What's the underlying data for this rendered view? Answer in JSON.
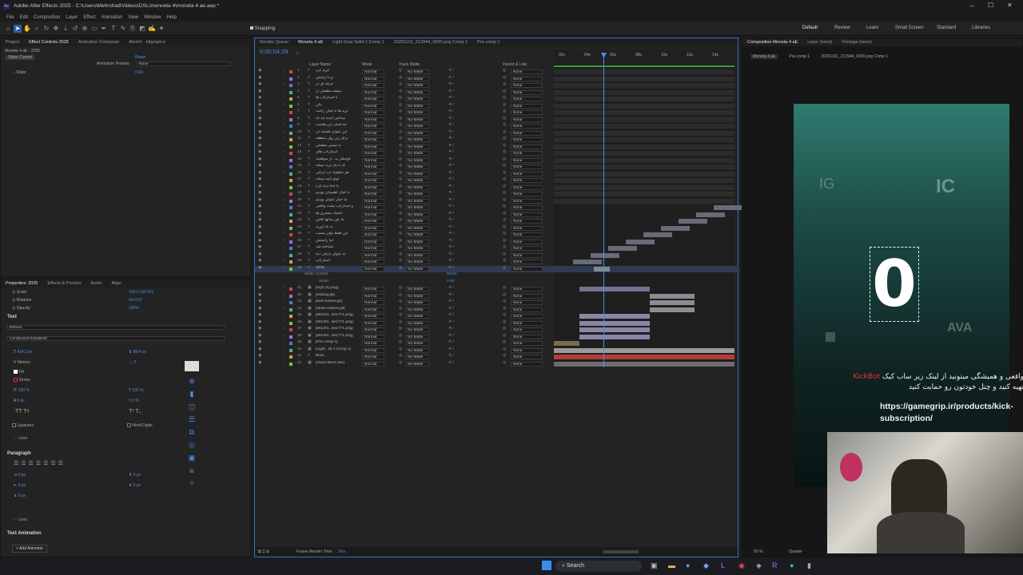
{
  "app": {
    "title": "Adobe After Effects 2025 - C:\\Users\\Mehrshad\\Videos\\DSL\\monneta 4\\moneta 4 ae.aep *",
    "menus": [
      "File",
      "Edit",
      "Composition",
      "Layer",
      "Effect",
      "Animation",
      "View",
      "Window",
      "Help"
    ],
    "snapping": "Snapping",
    "workspaces": [
      "Default",
      "Review",
      "Learn",
      "Small Screen",
      "Standard",
      "Libraries"
    ]
  },
  "left": {
    "tabs": [
      "Project",
      "Effect Controls 2025",
      "Animation Composer",
      "AtomX - bitgraph.ir"
    ],
    "ec_header": "Moneta 4 aE - 2025",
    "ec_layer": "Slider Control",
    "reset": "Reset",
    "anim_presets_label": "Animation Presets:",
    "anim_presets_value": "None",
    "slider_label": "Slider",
    "slider_value": "0.00"
  },
  "props": {
    "tabs": [
      "Properties: 2025",
      "Effects & Presets",
      "Audio",
      "Align"
    ],
    "transform": [
      {
        "name": "Scale",
        "value": "100.0,100.0%"
      },
      {
        "name": "Rotation",
        "value": "0x+0.0°"
      },
      {
        "name": "Opacity",
        "value": "100%"
      }
    ],
    "text_section": "Text",
    "font": "Roboto",
    "style": "Condensed ExtraBold",
    "size": "414.2 px",
    "leading": "88.4 px",
    "metrics": "Metrics",
    "tracking": "0",
    "fill": "Fill",
    "stroke": "Stroke",
    "scale_v": "100 %",
    "scale_h": "100 %",
    "baseline": "0 px",
    "tsume": "0 %",
    "ligatures": "Ligatures",
    "hindi": "Hindi Digits",
    "less": "Less",
    "paragraph": "Paragraph",
    "indent": "0 px",
    "text_animation": "Text Animation",
    "add_animator": "Add Animator"
  },
  "timeline": {
    "tabs": [
      "Render Queue",
      "Moneta 4 aE",
      "Light Gray Solid 1 Comp 1",
      "20251101_213944_0000.png Comp 1",
      "Pre-comp 1"
    ],
    "timecode": "0;00;04;29",
    "col_layer": "Layer Name",
    "col_mode": "Mode",
    "col_trkmat": "Track Matte",
    "col_parent": "Parent & Link",
    "ruler": [
      "02s",
      "04s",
      "06s",
      "08s",
      "10s",
      "12s",
      "14s"
    ],
    "layers": [
      {
        "n": "1",
        "name": "کرید کرد"
      },
      {
        "n": "2",
        "name": "و با آرامش"
      },
      {
        "n": "3",
        "name": "حرفه ای تر"
      },
      {
        "n": "4",
        "name": "میشه مطمئن تر"
      },
      {
        "n": "5",
        "name": "با استارتاپ ها"
      },
      {
        "n": "6",
        "name": "بگن"
      },
      {
        "n": "7",
        "name": "ترید ها با خیال راحت"
      },
      {
        "n": "8",
        "name": "ساختن آینده ایه که"
      },
      {
        "n": "9",
        "name": "اما هدف این هاست"
      },
      {
        "n": "10",
        "name": "این عنوان قشنگ آن"
      },
      {
        "n": "11",
        "name": "برای زیرِ رول منطقه"
      },
      {
        "n": "12",
        "name": "به مسیر مطمئن"
      },
      {
        "n": "13",
        "name": "استارتاپ های"
      },
      {
        "n": "14",
        "name": "کوچکتر یه.. از موفقیته"
      },
      {
        "n": "15",
        "name": "که با یک ترید میکنه"
      },
      {
        "n": "16",
        "name": "هر متفاوته آپ ابرالی"
      },
      {
        "n": "17",
        "name": "لوتو تایید میکنه"
      },
      {
        "n": "18",
        "name": "با جانا دنیا داره"
      },
      {
        "n": "19",
        "name": "با خیال اطمینان بودیم"
      },
      {
        "n": "20",
        "name": "ما خیال عنوان بودیم"
      },
      {
        "n": "21",
        "name": "و استارتاپ پشت واقعی"
      },
      {
        "n": "22",
        "name": "اعتماد مشتری ها"
      },
      {
        "n": "23",
        "name": "یاد آور سالها تلاش"
      },
      {
        "n": "24",
        "name": "به یاد آوریه"
      },
      {
        "n": "25",
        "name": "این فقط توان نیست"
      },
      {
        "n": "26",
        "name": "اما راستش"
      },
      {
        "n": "27",
        "name": "شناخته شد"
      },
      {
        "n": "28",
        "name": "به عنوان بارقی دنیا"
      },
      {
        "n": "29",
        "name": "استارتاپ"
      },
      {
        "n": "30",
        "name": "2025"
      },
      {
        "n": "31",
        "name": "[logo (2).png]"
      },
      {
        "n": "32",
        "name": "[trading.gif]"
      },
      {
        "n": "33",
        "name": "[bull-market.gif]"
      },
      {
        "n": "34",
        "name": "[stock-market.gif]"
      },
      {
        "n": "35",
        "name": "[b612f4...5e1771.png]"
      },
      {
        "n": "36",
        "name": "[b612f4...5e1771.png]"
      },
      {
        "n": "37",
        "name": "[b612f4...5e1771.png]"
      },
      {
        "n": "38",
        "name": "[b612f4...5e1771.png]"
      },
      {
        "n": "39",
        "name": "[Pre-comp 1]"
      },
      {
        "n": "40",
        "name": "[Light...lid 1 Comp 1]"
      },
      {
        "n": "41",
        "name": "Back"
      },
      {
        "n": "42",
        "name": "[Voice-lemiz.aac]"
      }
    ],
    "mode": "Normal",
    "matte": "No Matte",
    "parent": "None",
    "slider_control": "Slider Control",
    "slider": "Slider",
    "slider_reset": "Reset",
    "slider_val": "0.00",
    "frame_render": "Frame Render Time:",
    "frame_render_val": "2ms"
  },
  "comp": {
    "tabs": [
      "Composition Moneta 4 aE",
      "Layer (none)",
      "Footage (none)"
    ],
    "sub": [
      "Moneta 4 aE",
      "Pre-comp 1",
      "20251101_213944_0000.png Comp 1"
    ],
    "big_number": "0",
    "logo_left": "IG",
    "logo_right": "IC",
    "logo_bottom": "AVA",
    "overlay_name": "KickBot",
    "overlay_line1": "واقعی و همیشگی میتونید از لینک زیر ساب کیک",
    "overlay_line2": "تهیه کنید و چنل خودتون رو حمایت کنید",
    "overlay_url": "https://gamegrip.ir/products/kick-subscription/",
    "zoom": "50 %",
    "quality": "Quarter"
  },
  "taskbar": {
    "search": "Search"
  }
}
